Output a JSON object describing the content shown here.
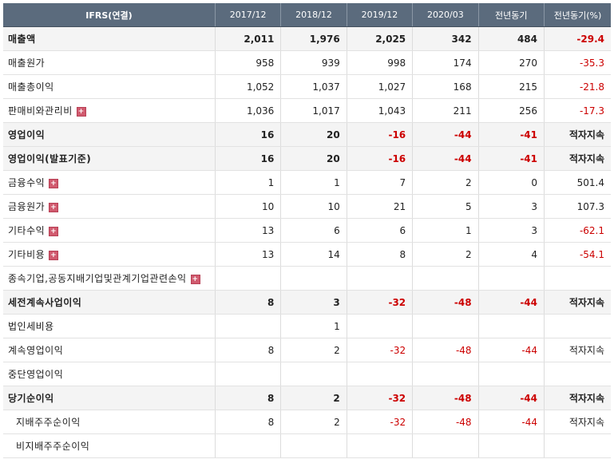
{
  "header": {
    "label": "IFRS(연결)",
    "cols": [
      "2017/12",
      "2018/12",
      "2019/12",
      "2020/03",
      "전년동기",
      "전년동기(%)"
    ]
  },
  "rows": [
    {
      "label": "매출액",
      "bold": true,
      "expand": false,
      "values": [
        "2,011",
        "1,976",
        "2,025",
        "342",
        "484",
        "-29.4"
      ]
    },
    {
      "label": "매출원가",
      "bold": false,
      "expand": false,
      "values": [
        "958",
        "939",
        "998",
        "174",
        "270",
        "-35.3"
      ]
    },
    {
      "label": "매출총이익",
      "bold": false,
      "expand": false,
      "values": [
        "1,052",
        "1,037",
        "1,027",
        "168",
        "215",
        "-21.8"
      ]
    },
    {
      "label": "판매비와관리비",
      "bold": false,
      "expand": true,
      "values": [
        "1,036",
        "1,017",
        "1,043",
        "211",
        "256",
        "-17.3"
      ]
    },
    {
      "label": "영업이익",
      "bold": true,
      "expand": false,
      "values": [
        "16",
        "20",
        "-16",
        "-44",
        "-41",
        "적자지속"
      ]
    },
    {
      "label": "영업이익(발표기준)",
      "bold": true,
      "expand": false,
      "values": [
        "16",
        "20",
        "-16",
        "-44",
        "-41",
        "적자지속"
      ]
    },
    {
      "label": "금융수익",
      "bold": false,
      "expand": true,
      "values": [
        "1",
        "1",
        "7",
        "2",
        "0",
        "501.4"
      ]
    },
    {
      "label": "금융원가",
      "bold": false,
      "expand": true,
      "values": [
        "10",
        "10",
        "21",
        "5",
        "3",
        "107.3"
      ]
    },
    {
      "label": "기타수익",
      "bold": false,
      "expand": true,
      "values": [
        "13",
        "6",
        "6",
        "1",
        "3",
        "-62.1"
      ]
    },
    {
      "label": "기타비용",
      "bold": false,
      "expand": true,
      "values": [
        "13",
        "14",
        "8",
        "2",
        "4",
        "-54.1"
      ]
    },
    {
      "label": "종속기업,공동지배기업및관계기업관련손익",
      "bold": false,
      "expand": true,
      "values": [
        "",
        "",
        "",
        "",
        "",
        ""
      ]
    },
    {
      "label": "세전계속사업이익",
      "bold": true,
      "expand": false,
      "values": [
        "8",
        "3",
        "-32",
        "-48",
        "-44",
        "적자지속"
      ]
    },
    {
      "label": "법인세비용",
      "bold": false,
      "expand": false,
      "values": [
        "",
        "1",
        "",
        "",
        "",
        ""
      ]
    },
    {
      "label": "계속영업이익",
      "bold": false,
      "expand": false,
      "values": [
        "8",
        "2",
        "-32",
        "-48",
        "-44",
        "적자지속"
      ]
    },
    {
      "label": "중단영업이익",
      "bold": false,
      "expand": false,
      "values": [
        "",
        "",
        "",
        "",
        "",
        ""
      ]
    },
    {
      "label": "당기순이익",
      "bold": true,
      "expand": false,
      "values": [
        "8",
        "2",
        "-32",
        "-48",
        "-44",
        "적자지속"
      ]
    },
    {
      "label": "지배주주순이익",
      "bold": false,
      "expand": false,
      "indent": true,
      "values": [
        "8",
        "2",
        "-32",
        "-48",
        "-44",
        "적자지속"
      ]
    },
    {
      "label": "비지배주주순이익",
      "bold": false,
      "expand": false,
      "indent": true,
      "values": [
        "",
        "",
        "",
        "",
        "",
        ""
      ]
    }
  ],
  "colors": {
    "header_bg": "#5b6b7d",
    "negative": "#cc0000",
    "bold_row_bg": "#f4f4f4",
    "expand_icon": "#d05a6e"
  }
}
